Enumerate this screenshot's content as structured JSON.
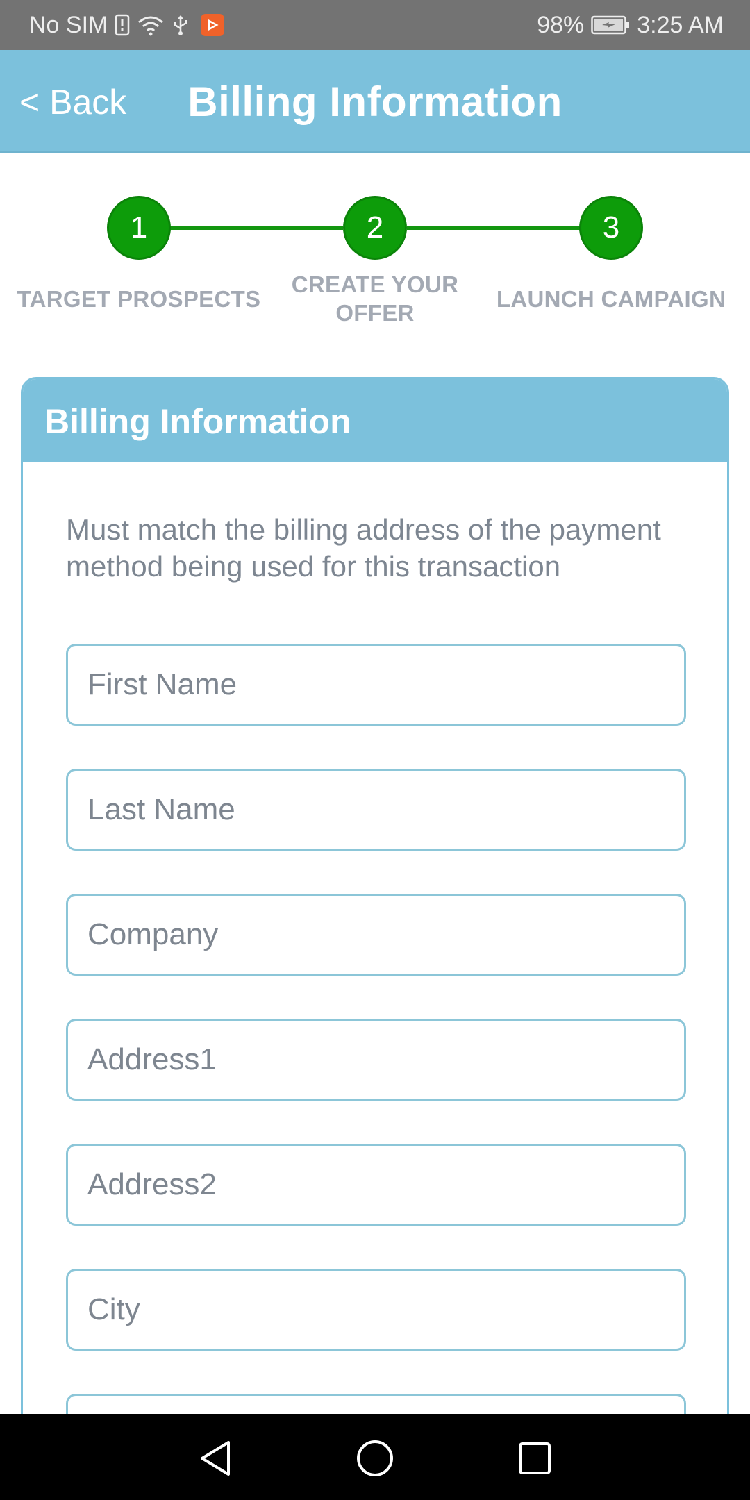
{
  "status_bar": {
    "carrier": "No SIM",
    "battery": "98%",
    "time": "3:25 AM",
    "icons": [
      "sim-alert-icon",
      "wifi-icon",
      "usb-icon",
      "app-notification-icon",
      "battery-charging-icon"
    ],
    "colors": {
      "background": "#737373",
      "app_badge": "#f0622a"
    }
  },
  "header": {
    "back_label": "< Back",
    "title": "Billing Information",
    "color": "#7cc1dc"
  },
  "stepper": {
    "color": "#0d9c0a",
    "steps": [
      {
        "number": "1",
        "label_line1": "TARGET PROSPECTS",
        "label_line2": ""
      },
      {
        "number": "2",
        "label_line1": "CREATE YOUR",
        "label_line2": "OFFER"
      },
      {
        "number": "3",
        "label_line1": "LAUNCH CAMPAIGN",
        "label_line2": ""
      }
    ]
  },
  "card": {
    "title": "Billing Information",
    "description": "Must match the billing address of the payment method being used for this transaction",
    "fields": [
      {
        "placeholder": "First Name",
        "value": ""
      },
      {
        "placeholder": "Last Name",
        "value": ""
      },
      {
        "placeholder": "Company",
        "value": ""
      },
      {
        "placeholder": "Address1",
        "value": ""
      },
      {
        "placeholder": "Address2",
        "value": ""
      },
      {
        "placeholder": "City",
        "value": ""
      },
      {
        "placeholder": "",
        "value": ""
      }
    ]
  },
  "nav_bar": {
    "buttons": [
      "back-triangle-icon",
      "home-circle-icon",
      "recents-square-icon"
    ]
  }
}
